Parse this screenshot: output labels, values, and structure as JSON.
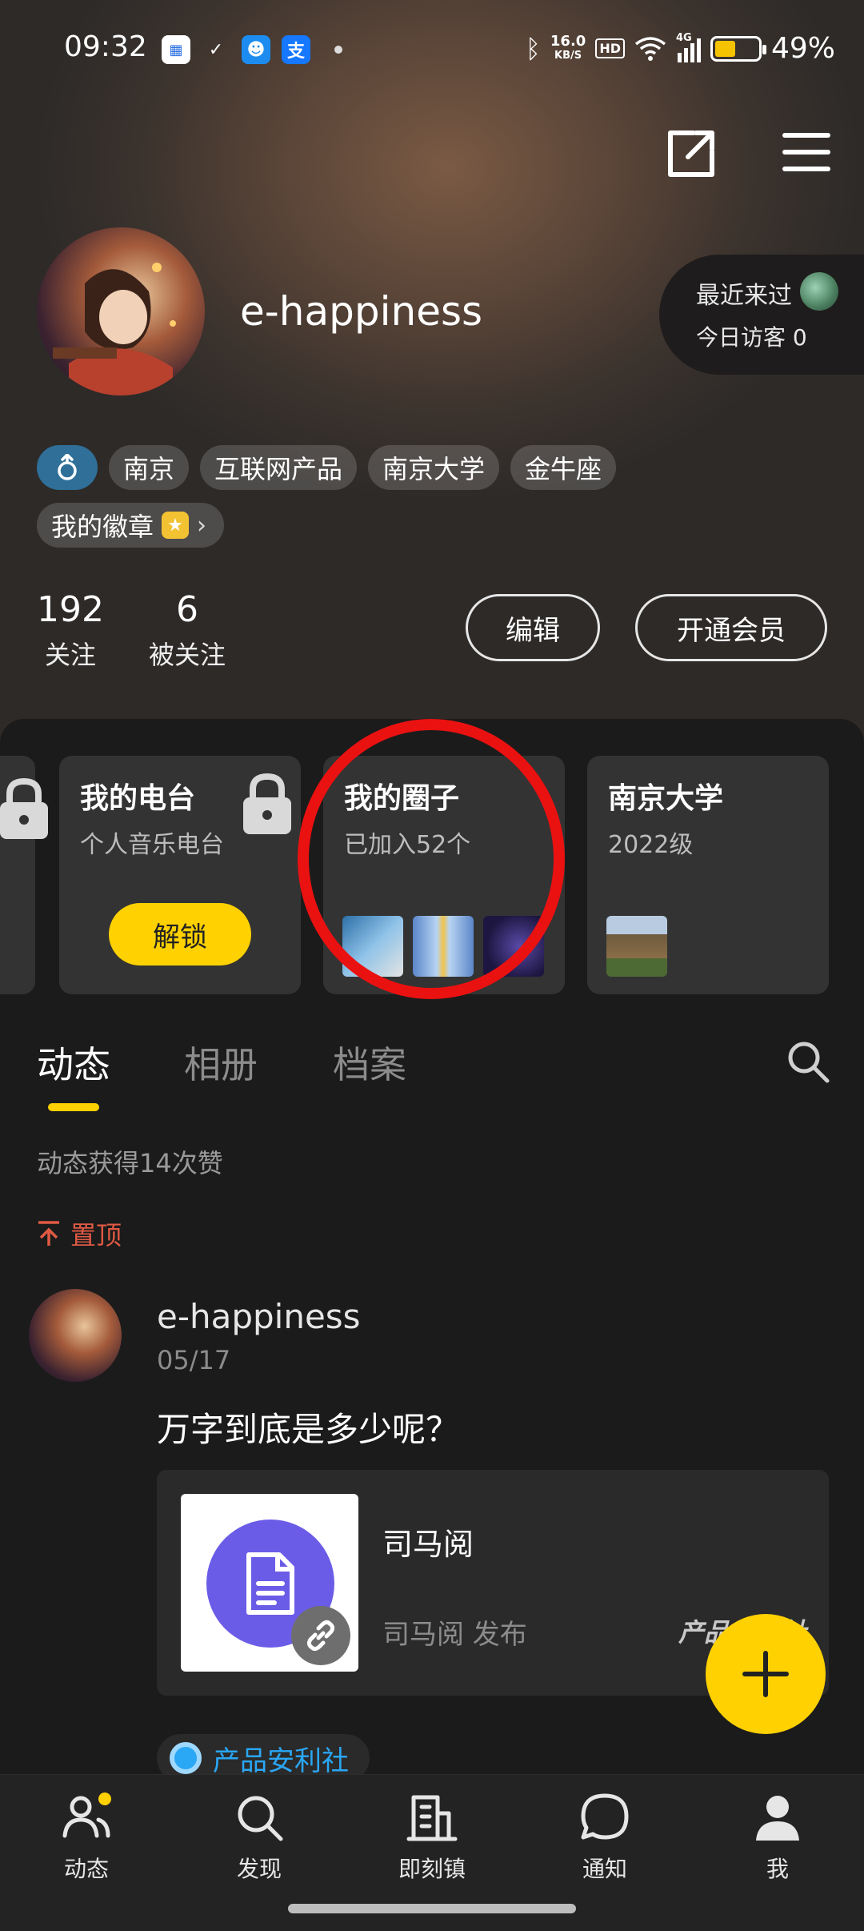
{
  "status_bar": {
    "time": "09:32",
    "net_speed": "16.0",
    "net_unit": "KB/S",
    "hd": "HD",
    "signal": "4G",
    "battery": "49%",
    "battery_level": 0.49
  },
  "profile": {
    "username": "e-happiness",
    "visitor_recent": "最近来过",
    "visitor_today": "今日访客 0",
    "tags": [
      "南京",
      "互联网产品",
      "南京大学",
      "金牛座"
    ],
    "gender_icon": "male-icon",
    "badges_label": "我的徽章",
    "following_count": "192",
    "following_label": "关注",
    "followers_count": "6",
    "followers_label": "被关注",
    "edit_label": "编辑",
    "vip_label": "开通会员"
  },
  "cards": [
    {
      "title": "我的电台",
      "subtitle": "个人音乐电台",
      "button": "解锁"
    },
    {
      "title": "我的圈子",
      "subtitle": "已加入52个"
    },
    {
      "title": "南京大学",
      "subtitle": "2022级"
    }
  ],
  "tabs": [
    "动态",
    "相册",
    "档案"
  ],
  "feed": {
    "likes_summary": "动态获得14次赞",
    "pinned_label": "置顶",
    "post": {
      "author": "e-happiness",
      "date": "05/17",
      "text": "万字到底是多少呢？",
      "link_title": "司马阅",
      "link_publisher": "司马阅 发布",
      "link_tag": "产品安利社"
    },
    "circle_chip": "产品安利社"
  },
  "bottom_nav": [
    "动态",
    "发现",
    "即刻镇",
    "通知",
    "我"
  ],
  "colors": {
    "accent": "#ffd100",
    "highlight_ring": "#ea1111",
    "pinned": "#e05a44",
    "link": "#2aa7f5"
  }
}
